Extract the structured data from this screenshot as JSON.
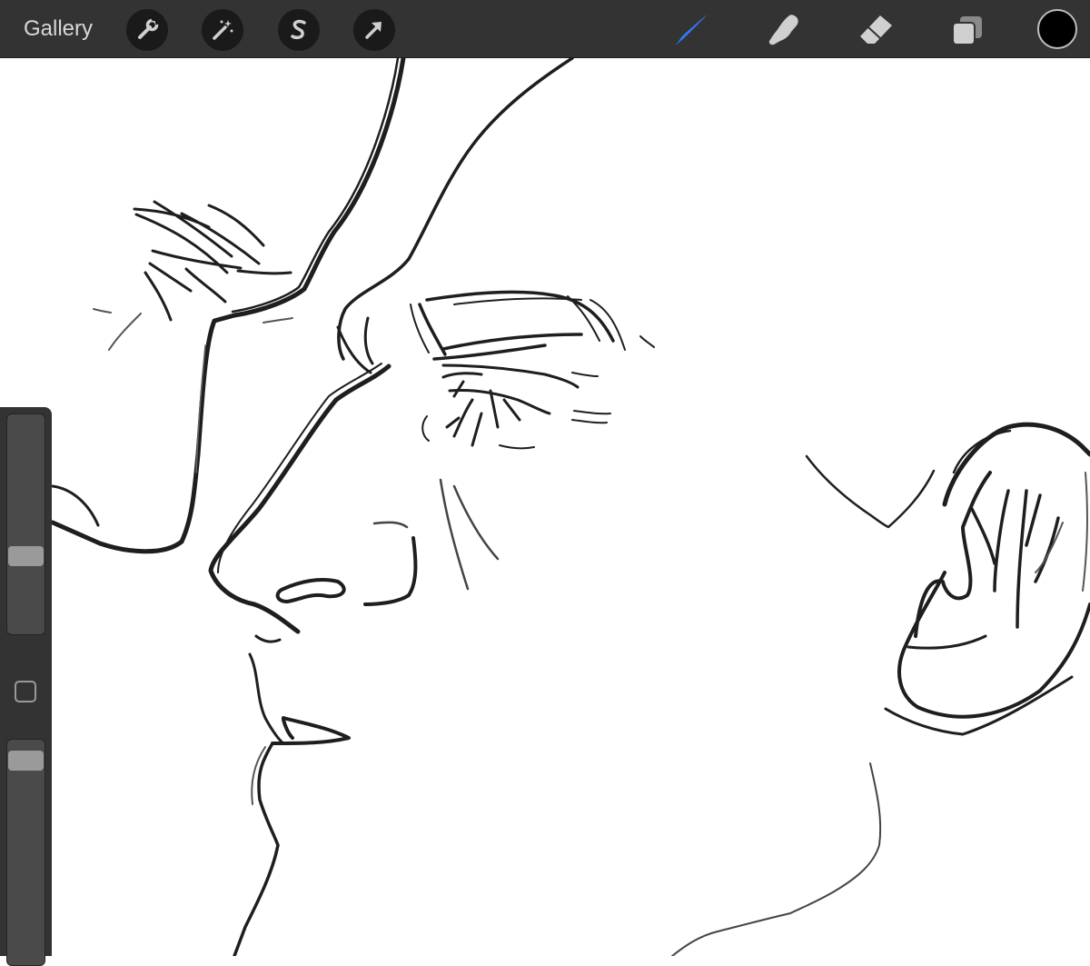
{
  "toolbar": {
    "gallery_label": "Gallery",
    "left_actions": [
      {
        "name": "actions",
        "icon": "wrench-icon"
      },
      {
        "name": "adjustments",
        "icon": "magic-wand-icon"
      },
      {
        "name": "selection",
        "icon": "selection-s-icon"
      },
      {
        "name": "transform",
        "icon": "arrow-cursor-icon"
      }
    ],
    "right_tools": [
      {
        "name": "brush",
        "icon": "brush-icon",
        "active": true
      },
      {
        "name": "smudge",
        "icon": "smudge-finger-icon",
        "active": false
      },
      {
        "name": "eraser",
        "icon": "eraser-icon",
        "active": false
      },
      {
        "name": "layers",
        "icon": "layers-icon",
        "active": false
      }
    ],
    "active_tool_color": "#2f7bf5",
    "current_color": "#000000"
  },
  "sidebar": {
    "brush_size_level": 0.34,
    "modify_button_icon": "square-modify-icon",
    "brush_opacity_level": 0.95
  },
  "canvas": {
    "background": "#ffffff",
    "ink_color": "#1e1e1e"
  }
}
